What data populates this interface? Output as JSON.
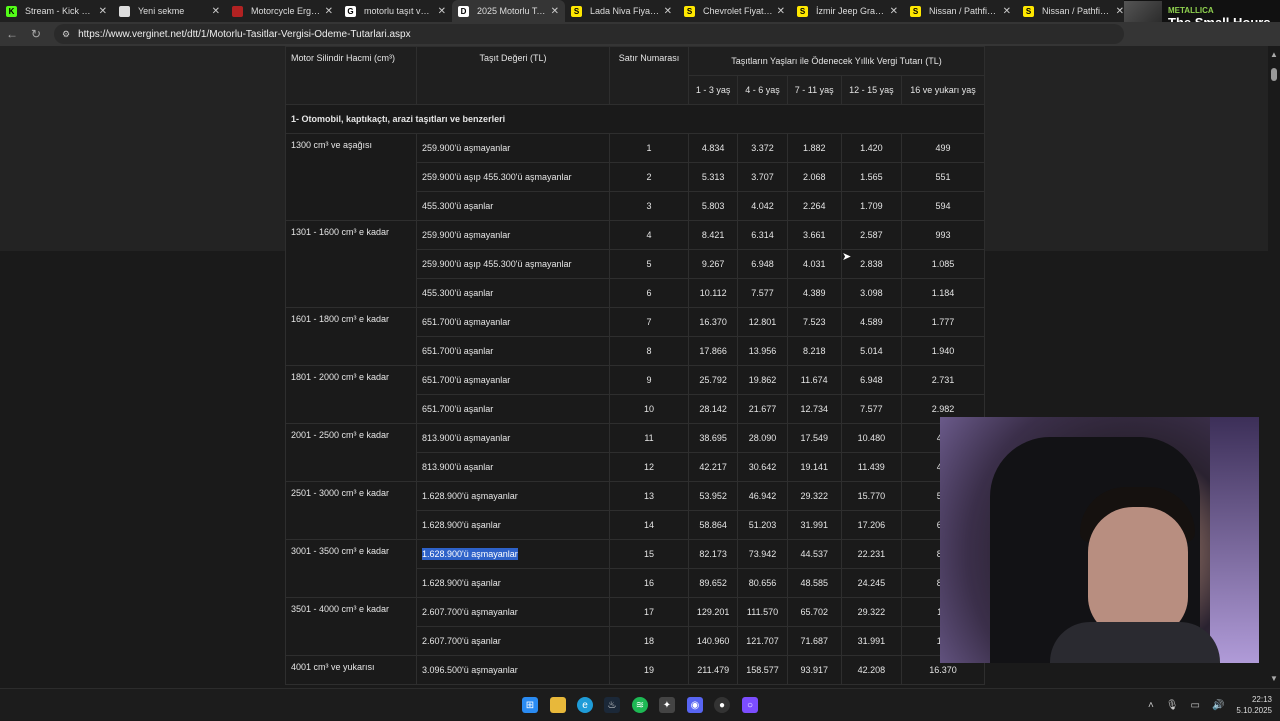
{
  "tabs": [
    {
      "title": "Stream - Kick Dashboard",
      "icon": "kick-icon",
      "color": "#53fc18",
      "glyph": "K",
      "active": false
    },
    {
      "title": "Yeni sekme",
      "icon": "new-tab-icon",
      "color": "#dddddd",
      "glyph": "",
      "active": false
    },
    {
      "title": "Motorcycle Ergonomics",
      "icon": "cycle-ergo-icon",
      "color": "#b22222",
      "glyph": "",
      "active": false
    },
    {
      "title": "motorlu taşıt vergi listesi",
      "icon": "google-icon",
      "color": "#ffffff",
      "glyph": "G",
      "active": false
    },
    {
      "title": "2025 Motorlu Taşıtlar Vergisi",
      "icon": "document-icon",
      "color": "#ffffff",
      "glyph": "D",
      "active": true
    },
    {
      "title": "Lada Niva Fiyatları & Modelleri",
      "icon": "sahibinden-icon",
      "color": "#ffe800",
      "glyph": "S",
      "active": false
    },
    {
      "title": "Chevrolet Fiyatları & Modelleri",
      "icon": "sahibinden-icon",
      "color": "#ffe800",
      "glyph": "S",
      "active": false
    },
    {
      "title": "İzmir Jeep Grand Cherokee",
      "icon": "sahibinden-icon",
      "color": "#ffe800",
      "glyph": "S",
      "active": false
    },
    {
      "title": "Nissan / Pathfinder / 3",
      "icon": "sahibinden-icon",
      "color": "#ffe800",
      "glyph": "S",
      "active": false
    },
    {
      "title": "Nissan / Pathfinder / 3",
      "icon": "sahibinden-icon",
      "color": "#ffe800",
      "glyph": "S",
      "active": false
    }
  ],
  "now_playing": {
    "artist": "METALLICA",
    "song": "The Small Hours"
  },
  "address": {
    "url": "https://www.verginet.net/dtt/1/Motorlu-Tasitlar-Vergisi-Odeme-Tutarlari.aspx"
  },
  "table": {
    "headers": {
      "engine": "Motor Silindir Hacmi (cm³)",
      "value": "Taşıt Değeri (TL)",
      "row_no": "Satır Numarası",
      "age_group": "Taşıtların Yaşları ile Ödenecek Yıllık Vergi Tutarı (TL)",
      "ages": [
        "1 - 3 yaş",
        "4 - 6 yaş",
        "7 - 11 yaş",
        "12 - 15 yaş",
        "16 ve yukarı yaş"
      ]
    },
    "category": "1- Otomobil, kaptıkaçtı, arazi taşıtları ve benzerleri",
    "groups": [
      {
        "engine": "1300 cm³ ve aşağısı",
        "rows": [
          {
            "value": "259.900'ü aşmayanlar",
            "no": "1",
            "taxes": [
              "4.834",
              "3.372",
              "1.882",
              "1.420",
              "499"
            ]
          },
          {
            "value": "259.900'ü aşıp 455.300'ü aşmayanlar",
            "no": "2",
            "taxes": [
              "5.313",
              "3.707",
              "2.068",
              "1.565",
              "551"
            ]
          },
          {
            "value": "455.300'ü aşanlar",
            "no": "3",
            "taxes": [
              "5.803",
              "4.042",
              "2.264",
              "1.709",
              "594"
            ]
          }
        ]
      },
      {
        "engine": "1301 - 1600 cm³ e kadar",
        "rows": [
          {
            "value": "259.900'ü aşmayanlar",
            "no": "4",
            "taxes": [
              "8.421",
              "6.314",
              "3.661",
              "2.587",
              "993"
            ]
          },
          {
            "value": "259.900'ü aşıp 455.300'ü aşmayanlar",
            "no": "5",
            "taxes": [
              "9.267",
              "6.948",
              "4.031",
              "2.838",
              "1.085"
            ]
          },
          {
            "value": "455.300'ü aşanlar",
            "no": "6",
            "taxes": [
              "10.112",
              "7.577",
              "4.389",
              "3.098",
              "1.184"
            ]
          }
        ]
      },
      {
        "engine": "1601 - 1800 cm³ e kadar",
        "rows": [
          {
            "value": "651.700'ü aşmayanlar",
            "no": "7",
            "taxes": [
              "16.370",
              "12.801",
              "7.523",
              "4.589",
              "1.777"
            ]
          },
          {
            "value": "651.700'ü aşanlar",
            "no": "8",
            "taxes": [
              "17.866",
              "13.956",
              "8.218",
              "5.014",
              "1.940"
            ]
          }
        ]
      },
      {
        "engine": "1801 - 2000 cm³ e kadar",
        "rows": [
          {
            "value": "651.700'ü aşmayanlar",
            "no": "9",
            "taxes": [
              "25.792",
              "19.862",
              "11.674",
              "6.948",
              "2.731"
            ]
          },
          {
            "value": "651.700'ü aşanlar",
            "no": "10",
            "taxes": [
              "28.142",
              "21.677",
              "12.734",
              "7.577",
              "2.982"
            ]
          }
        ]
      },
      {
        "engine": "2001 - 2500 cm³ e kadar",
        "rows": [
          {
            "value": "813.900'ü aşmayanlar",
            "no": "11",
            "taxes": [
              "38.695",
              "28.090",
              "17.549",
              "10.480",
              "4.1"
            ]
          },
          {
            "value": "813.900'ü aşanlar",
            "no": "12",
            "taxes": [
              "42.217",
              "30.642",
              "19.141",
              "11.439",
              "4.5"
            ]
          }
        ]
      },
      {
        "engine": "2501 - 3000 cm³ e kadar",
        "rows": [
          {
            "value": "1.628.900'ü aşmayanlar",
            "no": "13",
            "taxes": [
              "53.952",
              "46.942",
              "29.322",
              "15.770",
              "5.7"
            ]
          },
          {
            "value": "1.628.900'ü aşanlar",
            "no": "14",
            "taxes": [
              "58.864",
              "51.203",
              "31.991",
              "17.206",
              "6.3"
            ]
          }
        ]
      },
      {
        "engine": "3001 - 3500 cm³ e kadar",
        "rows": [
          {
            "value": "1.628.900'ü aşmayanlar",
            "no": "15",
            "taxes": [
              "82.173",
              "73.942",
              "44.537",
              "22.231",
              "8.1"
            ],
            "selected": true
          },
          {
            "value": "1.628.900'ü aşanlar",
            "no": "16",
            "taxes": [
              "89.652",
              "80.656",
              "48.585",
              "24.245",
              "8.8"
            ]
          }
        ]
      },
      {
        "engine": "3501 - 4000 cm³ e kadar",
        "rows": [
          {
            "value": "2.607.700'ü aşmayanlar",
            "no": "17",
            "taxes": [
              "129.201",
              "111.570",
              "65.702",
              "29.322",
              "11."
            ]
          },
          {
            "value": "2.607.700'ü aşanlar",
            "no": "18",
            "taxes": [
              "140.960",
              "121.707",
              "71.687",
              "31.991",
              "12."
            ]
          }
        ]
      },
      {
        "engine": "4001 cm³ ve yukarısı",
        "rows": [
          {
            "value": "3.096.500'ü aşmayanlar",
            "no": "19",
            "taxes": [
              "211.479",
              "158.577",
              "93.917",
              "42.208",
              "16.370"
            ]
          }
        ]
      }
    ]
  },
  "clock": {
    "time": "22:13",
    "date": "5.10.2025"
  }
}
